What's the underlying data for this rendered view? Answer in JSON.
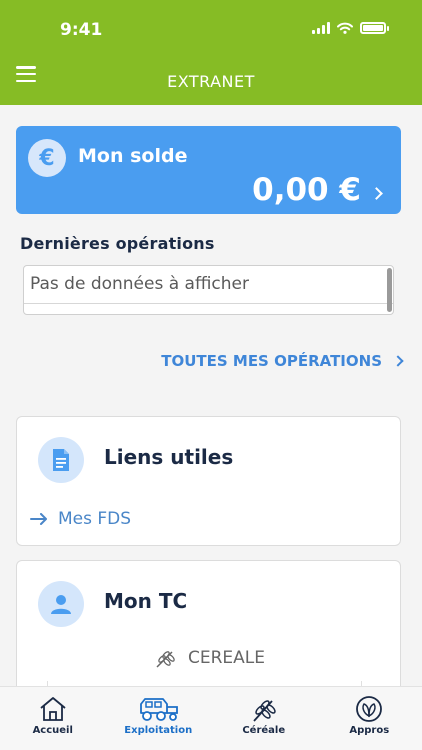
{
  "status_bar": {
    "time": "9:41"
  },
  "header": {
    "title": "EXTRANET"
  },
  "solde": {
    "title": "Mon solde",
    "amount": "0,00 €",
    "currency_symbol": "€"
  },
  "operations": {
    "heading": "Dernières opérations",
    "empty_text": "Pas de données à afficher",
    "all_link": "TOUTES MES OPÉRATIONS"
  },
  "liens_utiles": {
    "title": "Liens utiles",
    "link": "Mes FDS"
  },
  "mon_tc": {
    "title": "Mon TC",
    "category": "CEREALE"
  },
  "tabs": [
    {
      "label": "Accueil",
      "icon": "house-icon",
      "active": false
    },
    {
      "label": "Exploitation",
      "icon": "tractor-icon",
      "active": true
    },
    {
      "label": "Céréale",
      "icon": "wheat-icon",
      "active": false
    },
    {
      "label": "Appros",
      "icon": "leaf-icon",
      "active": false
    }
  ],
  "colors": {
    "header": "#86bc25",
    "accent": "#4a9df0",
    "link": "#3f86d8",
    "active_tab": "#1c6fc7"
  }
}
